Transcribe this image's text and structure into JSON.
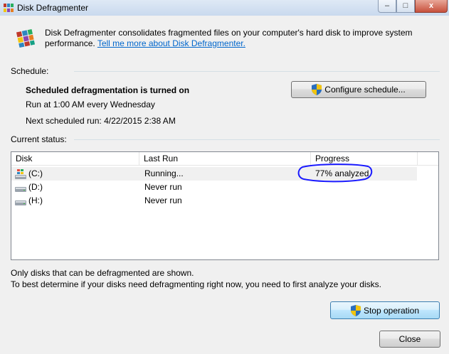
{
  "window": {
    "title": "Disk Defragmenter",
    "controls": {
      "minimize": "–",
      "maximize": "□",
      "close": "x"
    }
  },
  "description": {
    "text": "Disk Defragmenter consolidates fragmented files on your computer's hard disk to improve system performance. ",
    "link": "Tell me more about Disk Defragmenter."
  },
  "schedule": {
    "label": "Schedule:",
    "status": "Scheduled defragmentation is turned on",
    "run_at": "Run at 1:00 AM every Wednesday",
    "next_run": "Next scheduled run: 4/22/2015 2:38 AM",
    "configure_label": "Configure schedule..."
  },
  "current_status": {
    "label": "Current status:",
    "columns": {
      "disk": "Disk",
      "last_run": "Last Run",
      "progress": "Progress"
    },
    "rows": [
      {
        "disk": "(C:)",
        "last_run": "Running...",
        "progress": "77% analyzed",
        "icon": "system-drive-icon"
      },
      {
        "disk": "(D:)",
        "last_run": "Never run",
        "progress": "",
        "icon": "drive-icon"
      },
      {
        "disk": "(H:)",
        "last_run": "Never run",
        "progress": "",
        "icon": "drive-icon"
      }
    ]
  },
  "footer": {
    "note1": "Only disks that can be defragmented are shown.",
    "note2": "To best determine if your disks need defragmenting right now, you need to first analyze your disks.",
    "stop_label": "Stop operation",
    "close_label": "Close"
  },
  "colors": {
    "link": "#0066cc",
    "annotation": "#1a1aff",
    "accent": "#3c7fb1"
  }
}
